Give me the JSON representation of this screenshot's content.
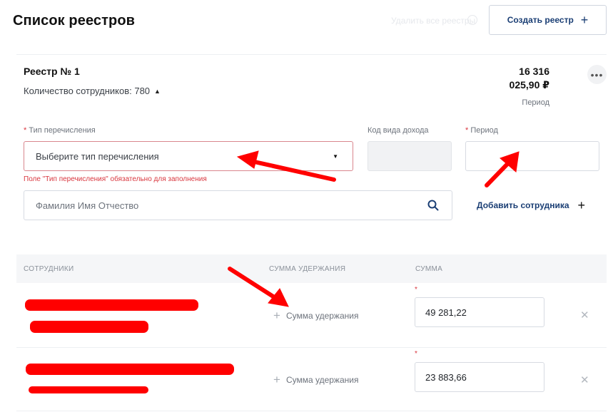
{
  "page": {
    "title": "Список реестров",
    "faded_label": "Удалить все реестры",
    "create_button_label": "Создать реестр",
    "create_button_icon": "plus-icon"
  },
  "registry": {
    "title": "Реестр № 1",
    "employees_count_label": "Количество сотрудников: 780",
    "total_line1": "16 316",
    "total_line2": "025,90 ₽",
    "period_label": "Период",
    "more_icon": "more-icon"
  },
  "form": {
    "transfer_type_label": "Тип перечисления",
    "transfer_type_placeholder": "Выберите тип перечисления",
    "transfer_type_error": "Поле \"Тип перечисления\" обязательно для заполнения",
    "income_code_label": "Код вида дохода",
    "period_label": "Период",
    "required_mark": "*",
    "search_placeholder": "Фамилия Имя Отчество",
    "add_employee_label": "Добавить сотрудника"
  },
  "table": {
    "columns": [
      "Сотрудники",
      "Сумма удержания",
      "Сумма"
    ],
    "rows": [
      {
        "deduction_label": "Сумма удержания",
        "amount": "49 281,22",
        "required_mark": "*"
      },
      {
        "deduction_label": "Сумма удержания",
        "amount": "23 883,66",
        "required_mark": "*"
      }
    ]
  },
  "colors": {
    "accent": "#1a3e74",
    "error": "#d9363e",
    "annotation": "#ff0000"
  }
}
